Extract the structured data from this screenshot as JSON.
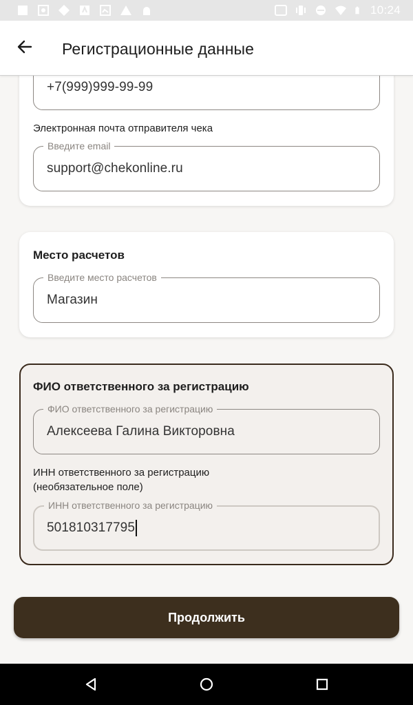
{
  "status_bar": {
    "time": "10:24",
    "left_icons": [
      "notification-square-icon",
      "gallery-icon",
      "location-diamond-icon",
      "store-icon",
      "image-icon",
      "warning-icon",
      "android-icon"
    ],
    "right_icons": [
      "cast-icon",
      "vibrate-icon",
      "do-not-disturb-icon",
      "wifi-icon",
      "battery-icon"
    ]
  },
  "app_bar": {
    "title": "Регистрационные данные",
    "back_icon": "arrow-left-icon"
  },
  "sender_card": {
    "phone_value": "+7(999)999-99-99",
    "email_section_label": "Электронная почта отправителя чека",
    "email_field_label": "Введите email",
    "email_value": "support@chekonline.ru"
  },
  "place_card": {
    "title": "Место расчетов",
    "field_label": "Введите место расчетов",
    "value": "Магазин"
  },
  "responsible_card": {
    "title": "ФИО ответственного за регистрацию",
    "name_field_label": "ФИО ответственного за регистрацию",
    "name_value": "Алексеева Галина Викторовна",
    "inn_section_label_line1": "ИНН ответственного за регистрацию",
    "inn_section_label_line2": "(необязательное поле)",
    "inn_field_label": "ИНН ответственного за регистрацию",
    "inn_value": "501810317795",
    "accent_color": "#3a2a1c"
  },
  "actions": {
    "continue_label": "Продолжить",
    "button_color": "#3d2f1e"
  },
  "nav_bar": {
    "icons": [
      "nav-back-icon",
      "nav-home-icon",
      "nav-recents-icon"
    ]
  }
}
